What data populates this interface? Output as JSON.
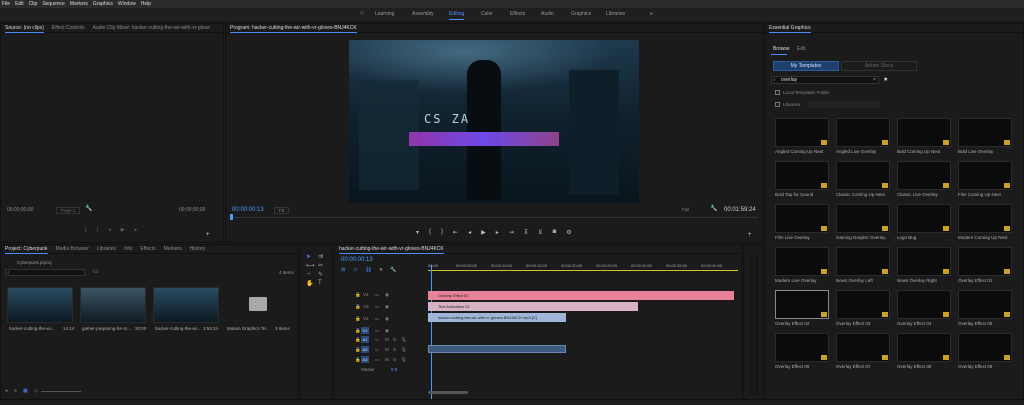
{
  "menu": [
    "File",
    "Edit",
    "Clip",
    "Sequence",
    "Markers",
    "Graphics",
    "Window",
    "Help"
  ],
  "workspaces": [
    "Learning",
    "Assembly",
    "Editing",
    "Color",
    "Effects",
    "Audio",
    "Graphics",
    "Libraries"
  ],
  "workspace_more": "»",
  "source_tabs": [
    "Source: (no clips)",
    "Effect Controls",
    "Audio Clip Mixer: hacker-cutting-the-wir-with-vr-glove"
  ],
  "source": {
    "timecode_left": "00;00;00;00",
    "page": "Page 1",
    "timecode_right": "00;00;00;00"
  },
  "program": {
    "title": "Program: hacker-cutting-the-wir-with-vr-gloves-BNJ4KCK",
    "timecode": "00:00:00:13",
    "fit": "Fit",
    "full": "Full",
    "duration": "00:01:59:24",
    "overlay_text": "CS ZA"
  },
  "project_tabs": [
    "Project: Cyberpunk",
    "Media Browser",
    "Libraries",
    "Info",
    "Effects",
    "Markers",
    "History"
  ],
  "project": {
    "file": "Cyberpunk.prproj",
    "items_count": "4 Items",
    "items": [
      {
        "name": "hacker-cutting-the-wi...",
        "dur": "14:14"
      },
      {
        "name": "gamer-preparing-for-m...",
        "dur": "20:00"
      },
      {
        "name": "hacker-cutting-the-wi...",
        "dur": "1:59:24"
      },
      {
        "name": "Motion Graphics Te...",
        "dur": "3 Items"
      }
    ]
  },
  "timeline": {
    "title": "hacker-cutting-the-wir-with-vr-gloves-BNJ4KCK",
    "timecode": "00:00:00:13",
    "ruler": [
      "00:00",
      "00:00:05:00",
      "00:00:10:00",
      "00:00:15:00",
      "00:00:20:00",
      "00:00:25:00",
      "00:00:30:00",
      "00:00:35:00",
      "00:00:40:00"
    ],
    "video_tracks": [
      "V4",
      "V3",
      "V2",
      "V1"
    ],
    "audio_tracks": [
      "A1",
      "A2",
      "A3"
    ],
    "master": "Master",
    "master_val": "0.0",
    "clips": [
      {
        "label": "Overlay Effect 02",
        "color": "#e7829a"
      },
      {
        "label": "Text Animation 02",
        "color": "#d7b2c4"
      },
      {
        "label": "hacker-cutting-the-wir-with-vr-gloves-BNJ4KCK.mp4 [V]",
        "color": "#9fb6d8"
      }
    ]
  },
  "eg": {
    "title": "Essential Graphics",
    "tabs": [
      "Browse",
      "Edit"
    ],
    "my_templates": "My Templates",
    "adobe_stock": "Adobe Stock",
    "search": "overlay",
    "local_folder": "Local Templates Folder",
    "libraries": "Libraries",
    "templates": [
      "Angled Coming Up Next",
      "Angled Live Overlay",
      "Bold Coming Up Next",
      "Bold Live Overlay",
      "Bold Tap for Sound",
      "Classic Coming Up Next",
      "Classic Live Overlay",
      "Film Coming Up Next",
      "Film Live Overlay",
      "Gaming Graphic Overlay",
      "Logo Bug",
      "Modern Coming Up Next",
      "Modern Live Overlay",
      "News Overlay Left",
      "News Overlay Right",
      "Overlay Effect 01",
      "Overlay Effect 02",
      "Overlay Effect 03",
      "Overlay Effect 04",
      "Overlay Effect 05",
      "Overlay Effect 06",
      "Overlay Effect 07",
      "Overlay Effect 08",
      "Overlay Effect 09"
    ]
  },
  "colors": {
    "accent": "#4a8cff",
    "playhead": "#4a9bff",
    "clip_pink": "#e7829a",
    "clip_light": "#d7b2c4",
    "clip_blue": "#9fb6d8"
  }
}
